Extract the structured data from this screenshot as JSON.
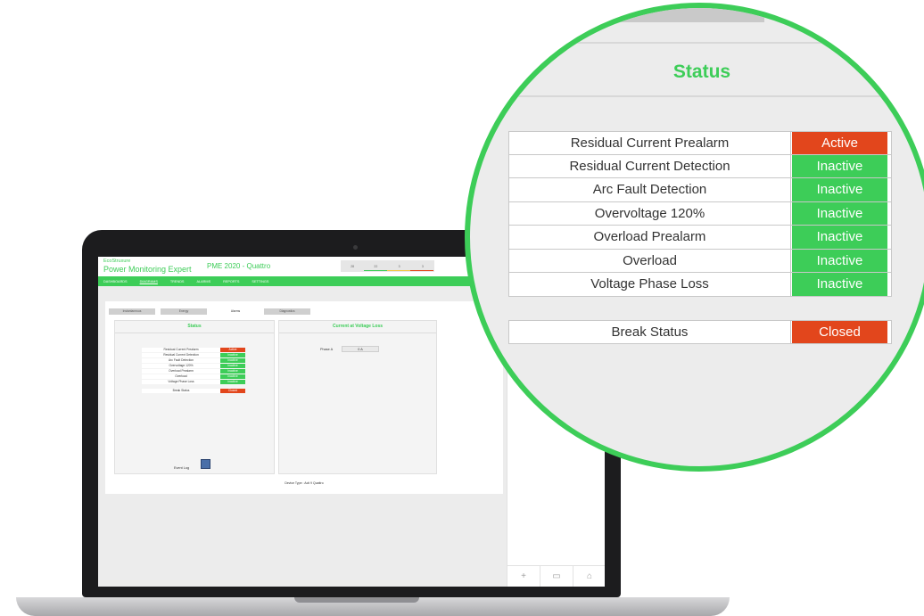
{
  "app": {
    "logo": "EcoStruxure",
    "product": "Power Monitoring Expert",
    "title": "PME 2020 - Quattro",
    "counters": [
      "28",
      "22",
      "3",
      "3"
    ],
    "nav": [
      "DASHBOARDS",
      "DIAGRAMS",
      "TRENDS",
      "ALARMS",
      "REPORTS",
      "SETTINGS"
    ]
  },
  "content": {
    "subtabs": [
      "Instantaneous",
      "Energy",
      "Alarms",
      "Diagnostics"
    ],
    "status_panel": {
      "title": "Status"
    },
    "current_panel": {
      "title": "Current at Voltage Loss",
      "phase_label": "Phase A",
      "phase_value": "0 A"
    },
    "event_log_label": "Event Log",
    "device_type": "Device Type : Acti 9 Quattro"
  },
  "status": {
    "title": "Status",
    "rows": [
      {
        "name": "Residual Current Prealarm",
        "value": "Active"
      },
      {
        "name": "Residual Current Detection",
        "value": "Inactive"
      },
      {
        "name": "Arc Fault Detection",
        "value": "Inactive"
      },
      {
        "name": "Overvoltage 120%",
        "value": "Inactive"
      },
      {
        "name": "Overload Prealarm",
        "value": "Inactive"
      },
      {
        "name": "Overload",
        "value": "Inactive"
      },
      {
        "name": "Voltage Phase Loss",
        "value": "Inactive"
      }
    ],
    "break": {
      "name": "Break Status",
      "value": "Closed"
    }
  },
  "side_panel": {
    "buttons": [
      "+",
      "▭",
      "⌂"
    ]
  },
  "colors": {
    "brand": "#3dcd58",
    "active": "#e2461c",
    "inactive": "#3dcd58",
    "closed": "#e2461c"
  }
}
